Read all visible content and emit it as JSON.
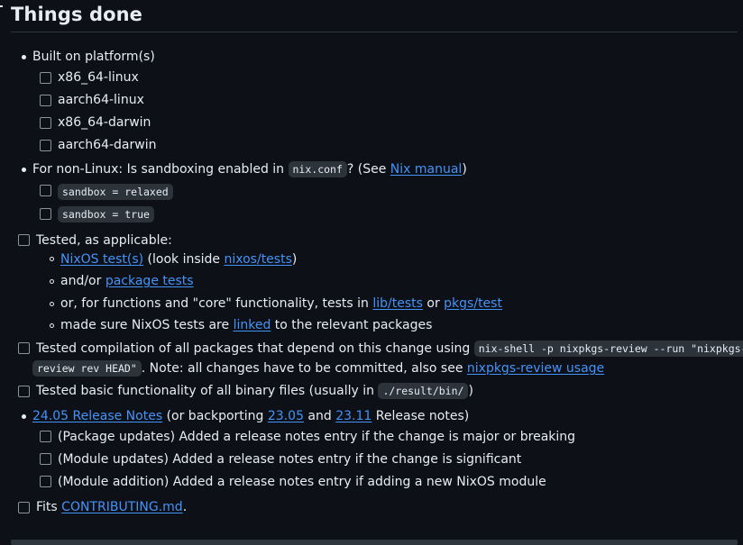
{
  "title": "Things done",
  "built": {
    "label": "Built on platform(s)",
    "platforms": [
      "x86_64-linux",
      "aarch64-linux",
      "x86_64-darwin",
      "aarch64-darwin"
    ]
  },
  "sandbox": {
    "pre": "For non-Linux: Is sandboxing enabled in ",
    "code": "nix.conf",
    "mid": "? (See ",
    "link": "Nix manual",
    "post": ")",
    "options": [
      "sandbox = relaxed",
      "sandbox = true"
    ]
  },
  "tested": {
    "label": "Tested, as applicable:",
    "sub1": {
      "link1": "NixOS test(s)",
      "mid": " (look inside ",
      "link2": "nixos/tests",
      "post": ")"
    },
    "sub2": {
      "pre": "and/or ",
      "link": "package tests"
    },
    "sub3": {
      "pre": "or, for functions and \"core\" functionality, tests in ",
      "link1": "lib/tests",
      "mid": " or ",
      "link2": "pkgs/test"
    },
    "sub4": {
      "pre": "made sure NixOS tests are ",
      "link": "linked",
      "post": " to the relevant packages"
    }
  },
  "compilation": {
    "pre": "Tested compilation of all packages that depend on this change using ",
    "code1": "nix-shell -p nixpkgs-review --run \"nixpkgs-",
    "code2": "review rev HEAD\"",
    "mid": ". Note: all changes have to be committed, also see ",
    "link": "nixpkgs-review usage"
  },
  "binaries": {
    "pre": "Tested basic functionality of all binary files (usually in ",
    "code": "./result/bin/",
    "post": ")"
  },
  "release": {
    "link1": "24.05 Release Notes",
    "mid1": " (or backporting ",
    "link2": "23.05",
    "mid2": " and ",
    "link3": "23.11",
    "post": " Release notes)",
    "items": [
      "(Package updates) Added a release notes entry if the change is major or breaking",
      "(Module updates) Added a release notes entry if the change is significant",
      "(Module addition) Added a release notes entry if adding a new NixOS module"
    ]
  },
  "fits": {
    "pre": "Fits ",
    "link": "CONTRIBUTING.md",
    "post": "."
  }
}
